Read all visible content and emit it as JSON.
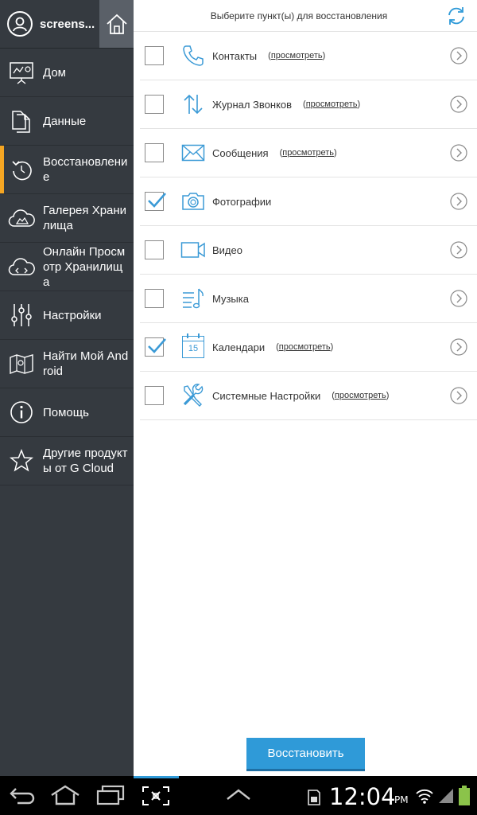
{
  "sidebar": {
    "username": "screens...",
    "items": [
      {
        "label": "Дом",
        "icon": "presentation-icon",
        "active": false
      },
      {
        "label": "Данные",
        "icon": "files-icon",
        "active": false
      },
      {
        "label": "Восстановление",
        "icon": "restore-icon",
        "active": true
      },
      {
        "label": "Галерея Хранилища",
        "icon": "cloud-gallery-icon",
        "active": false
      },
      {
        "label": "Онлайн Просмотр Хранилища",
        "icon": "cloud-browse-icon",
        "active": false
      },
      {
        "label": "Настройки",
        "icon": "sliders-icon",
        "active": false
      },
      {
        "label": "Найти Мой Android",
        "icon": "map-icon",
        "active": false
      },
      {
        "label": "Помощь",
        "icon": "info-icon",
        "active": false
      },
      {
        "label": "Другие продукты от G Cloud",
        "icon": "star-icon",
        "active": false
      }
    ]
  },
  "main": {
    "title": "Выберите пункт(ы) для восстановления",
    "rows": [
      {
        "label": "Контакты",
        "link": "просмотреть",
        "checked": false,
        "icon": "phone-icon"
      },
      {
        "label": "Журнал Звонков",
        "link": "просмотреть",
        "checked": false,
        "icon": "call-log-icon"
      },
      {
        "label": "Сообщения",
        "link": "просмотреть",
        "checked": false,
        "icon": "envelope-icon"
      },
      {
        "label": "Фотографии",
        "link": "",
        "checked": true,
        "icon": "camera-icon"
      },
      {
        "label": "Видео",
        "link": "",
        "checked": false,
        "icon": "video-icon"
      },
      {
        "label": "Музыка",
        "link": "",
        "checked": false,
        "icon": "music-icon"
      },
      {
        "label": "Календари",
        "link": "просмотреть",
        "checked": true,
        "icon": "calendar-icon",
        "calendar_day": "15"
      },
      {
        "label": "Системные Настройки",
        "link": "просмотреть",
        "checked": false,
        "icon": "tools-icon"
      }
    ],
    "restore_label": "Восстановить"
  },
  "statusbar": {
    "time": "12:04",
    "ampm": "PM"
  },
  "colors": {
    "accent": "#2f9ad8",
    "active_marker": "#f5a623",
    "sidebar_bg": "#353a40",
    "battery": "#8bc34a"
  }
}
